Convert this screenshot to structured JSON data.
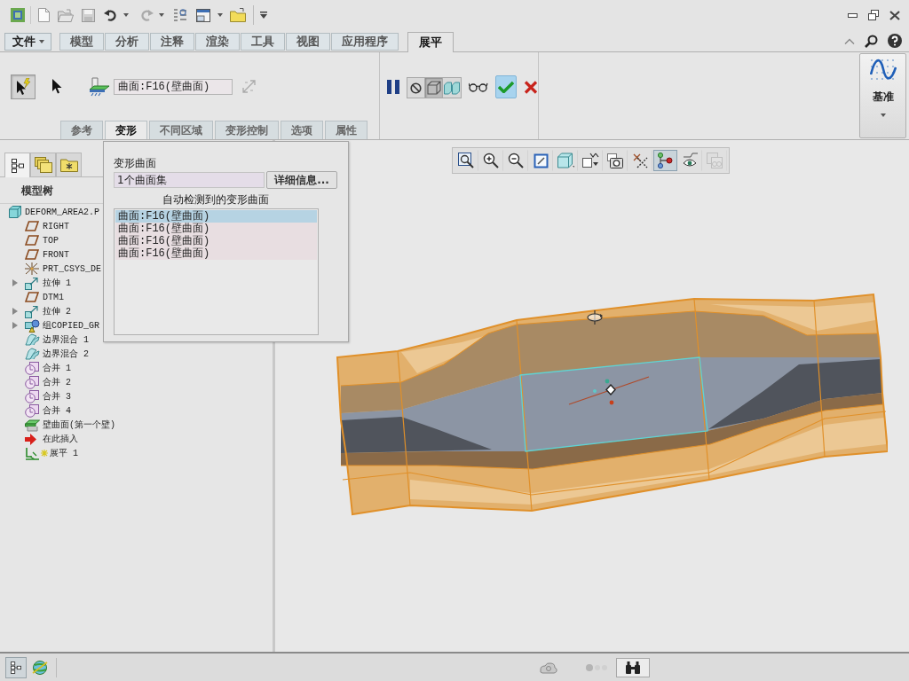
{
  "menu_button": {
    "label": "文件"
  },
  "ribbon_tabs": [
    {
      "label": "模型",
      "selected": false
    },
    {
      "label": "分析",
      "selected": false
    },
    {
      "label": "注释",
      "selected": false
    },
    {
      "label": "渲染",
      "selected": false
    },
    {
      "label": "工具",
      "selected": false
    },
    {
      "label": "视图",
      "selected": false
    },
    {
      "label": "应用程序",
      "selected": false
    },
    {
      "label": "展平",
      "selected": true
    }
  ],
  "ribbon": {
    "select_tools": [
      {
        "kind": "smart",
        "pressed": true
      },
      {
        "kind": "pointer",
        "pressed": false
      }
    ],
    "surface_field": {
      "value": "曲面:F16(壁曲面)"
    },
    "sub_tabs": [
      {
        "label": "参考",
        "selected": false
      },
      {
        "label": "变形",
        "selected": true
      },
      {
        "label": "不同区域",
        "selected": false
      },
      {
        "label": "变形控制",
        "selected": false
      },
      {
        "label": "选项",
        "selected": false
      },
      {
        "label": "属性",
        "selected": false
      }
    ],
    "display_modes": [
      {
        "kind": "none",
        "pressed": false
      },
      {
        "kind": "wire",
        "pressed": true
      },
      {
        "kind": "shaded",
        "pressed": false
      }
    ],
    "datum_button": {
      "label": "基准"
    }
  },
  "sidebar": {
    "tabs": [
      {
        "kind": "tree",
        "selected": true
      },
      {
        "kind": "layers",
        "selected": false
      },
      {
        "kind": "favorites",
        "selected": false
      }
    ],
    "heading": "模型树",
    "tree": [
      {
        "label": "DEFORM_AREA2.P",
        "kind": "part",
        "children": [
          {
            "label": "RIGHT",
            "kind": "plane"
          },
          {
            "label": "TOP",
            "kind": "plane"
          },
          {
            "label": "FRONT",
            "kind": "plane"
          },
          {
            "label": "PRT_CSYS_DE",
            "kind": "csys"
          },
          {
            "label": "拉伸 1",
            "kind": "extrude",
            "expanded": false
          },
          {
            "label": "DTM1",
            "kind": "plane"
          },
          {
            "label": "拉伸 2",
            "kind": "extrude",
            "expanded": false
          },
          {
            "label": "组COPIED_GR",
            "kind": "group",
            "expanded": false
          },
          {
            "label": "边界混合 1",
            "kind": "blend"
          },
          {
            "label": "边界混合 2",
            "kind": "blend"
          },
          {
            "label": "合并 1",
            "kind": "merge"
          },
          {
            "label": "合并 2",
            "kind": "merge"
          },
          {
            "label": "合并 3",
            "kind": "merge"
          },
          {
            "label": "合并 4",
            "kind": "merge"
          },
          {
            "label": "壁曲面(第一个壁)",
            "kind": "wall"
          },
          {
            "label": "在此插入",
            "kind": "insert"
          },
          {
            "label": "展平 1",
            "kind": "flatten"
          }
        ]
      }
    ]
  },
  "deform_panel": {
    "label": "变形曲面",
    "collector": {
      "value": "1个曲面集"
    },
    "details_button": "详细信息...",
    "list_title": "自动检测到的变形曲面",
    "items": [
      {
        "label": "曲面:F16(壁曲面)",
        "selected": true
      },
      {
        "label": "曲面:F16(壁曲面)",
        "selected": false
      },
      {
        "label": "曲面:F16(壁曲面)",
        "selected": false
      },
      {
        "label": "曲面:F16(壁曲面)",
        "selected": false
      }
    ]
  },
  "view_toolbar": [
    {
      "kind": "refit",
      "pressed": false,
      "disabled": false
    },
    {
      "kind": "zoom_in",
      "pressed": false,
      "disabled": false
    },
    {
      "kind": "zoom_out",
      "pressed": false,
      "disabled": false
    },
    {
      "kind": "repaint",
      "pressed": false,
      "disabled": false
    },
    {
      "kind": "display_style",
      "pressed": false,
      "disabled": false
    },
    {
      "kind": "annotations",
      "pressed": false,
      "disabled": false
    },
    {
      "kind": "views",
      "pressed": false,
      "disabled": false
    },
    {
      "kind": "datum",
      "pressed": false,
      "disabled": false
    },
    {
      "kind": "graph",
      "pressed": true,
      "disabled": false
    },
    {
      "kind": "view_manager",
      "pressed": false,
      "disabled": false
    },
    {
      "kind": "stack",
      "pressed": false,
      "disabled": true
    }
  ],
  "status_bar": {
    "tools": [
      {
        "kind": "tree",
        "pressed": true
      },
      {
        "kind": "globe",
        "pressed": false
      }
    ]
  }
}
